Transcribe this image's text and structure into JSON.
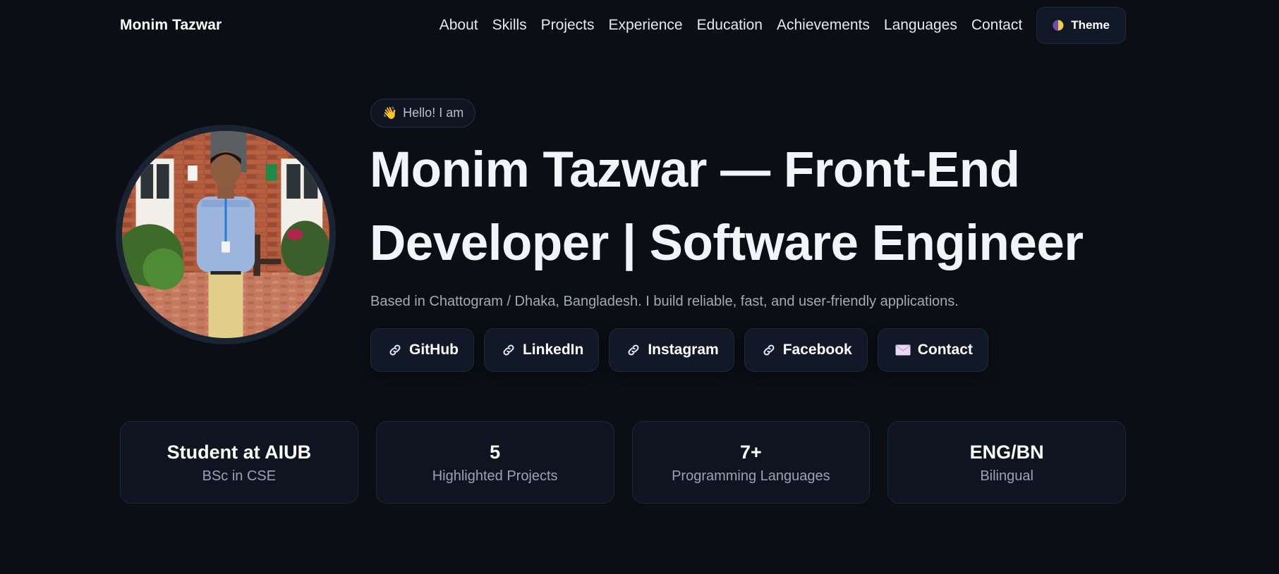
{
  "brand": "Monim Tazwar",
  "nav": {
    "links": [
      "About",
      "Skills",
      "Projects",
      "Experience",
      "Education",
      "Achievements",
      "Languages",
      "Contact"
    ],
    "theme_label": "Theme",
    "theme_icon": "half-moon-icon"
  },
  "hero": {
    "badge_emoji": "👋",
    "badge_text": "Hello! I am",
    "title": "Monim Tazwar — Front-End Developer | Software Engineer",
    "subtitle": "Based in Chattogram / Dhaka, Bangladesh. I build reliable, fast, and user-friendly applications.",
    "avatar_icon": "profile-photo"
  },
  "socials": [
    {
      "label": "GitHub",
      "icon": "link-icon"
    },
    {
      "label": "LinkedIn",
      "icon": "link-icon"
    },
    {
      "label": "Instagram",
      "icon": "link-icon"
    },
    {
      "label": "Facebook",
      "icon": "link-icon"
    },
    {
      "label": "Contact",
      "icon": "mail-icon"
    }
  ],
  "stats": [
    {
      "value": "Student at AIUB",
      "label": "BSc in CSE"
    },
    {
      "value": "5",
      "label": "Highlighted Projects"
    },
    {
      "value": "7+",
      "label": "Programming Languages"
    },
    {
      "value": "ENG/BN",
      "label": "Bilingual"
    }
  ],
  "colors": {
    "background": "#0b0e14",
    "card": "#0f1520",
    "button": "#111827",
    "text": "#f3f4f7",
    "muted": "#a3aab8"
  }
}
